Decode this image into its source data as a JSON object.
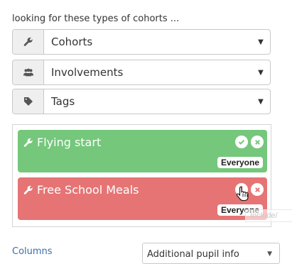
{
  "intro_text": "looking for these types of cohorts ...",
  "filters": [
    {
      "label": "Cohorts",
      "icon": "wrench-icon"
    },
    {
      "label": "Involvements",
      "icon": "users-icon"
    },
    {
      "label": "Tags",
      "icon": "tag-icon"
    }
  ],
  "caret": "▼",
  "cohorts": [
    {
      "name": "Flying start",
      "status": "included",
      "color": "#74c77b",
      "badge": "Everyone"
    },
    {
      "name": "Free School Meals",
      "status": "excluded",
      "color": "#e67474",
      "badge": "Everyone"
    }
  ],
  "tooltip": "Include/",
  "columns": {
    "label": "Columns",
    "selected": "Additional pupil info"
  }
}
